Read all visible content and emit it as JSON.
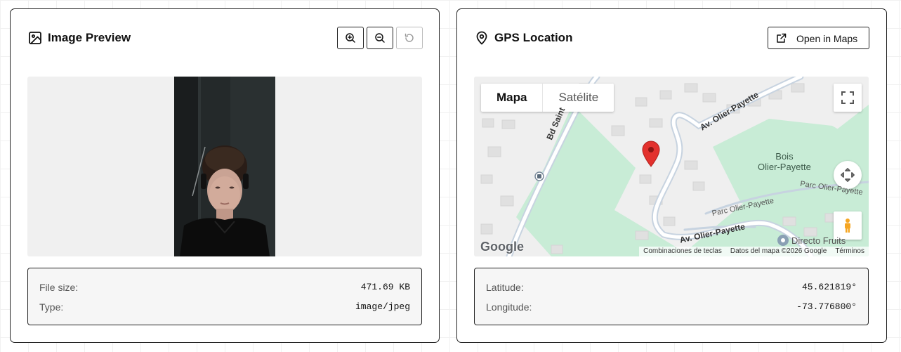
{
  "image_card": {
    "title": "Image Preview",
    "icon": "image-icon",
    "toolbar": {
      "zoom_in_icon": "zoom-in-icon",
      "zoom_out_icon": "zoom-out-icon",
      "reset_icon": "reset-icon"
    },
    "info": [
      {
        "label": "File size:",
        "value": "471.69 KB"
      },
      {
        "label": "Type:",
        "value": "image/jpeg"
      }
    ]
  },
  "gps_card": {
    "title": "GPS Location",
    "icon": "map-pin-icon",
    "open_button_label": "Open in Maps",
    "open_button_icon": "external-link-icon",
    "map": {
      "type_tabs": [
        "Mapa",
        "Satélite"
      ],
      "active_tab": "Mapa",
      "place_label": "Bois\nOlier-Payette",
      "street_labels": [
        "Av. Olier-Payette",
        "Bd Saint",
        "Parc Olier-Payette",
        "Parc Olier-Payette",
        "Av. Olier-Payette"
      ],
      "poi_label": "Directo Fruits",
      "logo_text": "Google",
      "attribution": [
        "Combinaciones de teclas",
        "Datos del mapa ©2026 Google",
        "Términos"
      ],
      "colors": {
        "park": "#c8ecd6",
        "road": "#c7d3e0",
        "building": "#e2e2e2",
        "pin": "#e3312d"
      }
    },
    "info": [
      {
        "label": "Latitude:",
        "value": "45.621819°"
      },
      {
        "label": "Longitude:",
        "value": "-73.776800°"
      }
    ]
  }
}
